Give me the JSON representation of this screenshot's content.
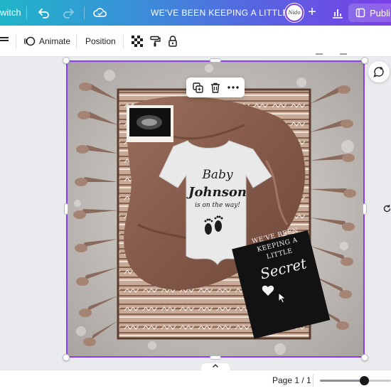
{
  "topbar": {
    "switch_label": "witch",
    "title": "WE'VE BEEN KEEPING A LITTLE",
    "avatar_text": "Nido",
    "publish_label": "Publi"
  },
  "toolbar": {
    "animate_label": "Animate",
    "position_label": "Position"
  },
  "design": {
    "onesie_line1": "Baby",
    "onesie_line2": "Johnson",
    "onesie_line3": "is on the way!",
    "sign_line1": "WE'VE BEEN",
    "sign_line2": "KEEPING A",
    "sign_line3": "LITTLE",
    "sign_line4": "Secret"
  },
  "footer": {
    "page_label": "Page 1 / 1",
    "zoom_fraction": 0.62
  },
  "colors": {
    "selection": "#8b3dff",
    "topbar_gradient_start": "#1fb5c9",
    "topbar_gradient_end": "#7b3fe6"
  }
}
